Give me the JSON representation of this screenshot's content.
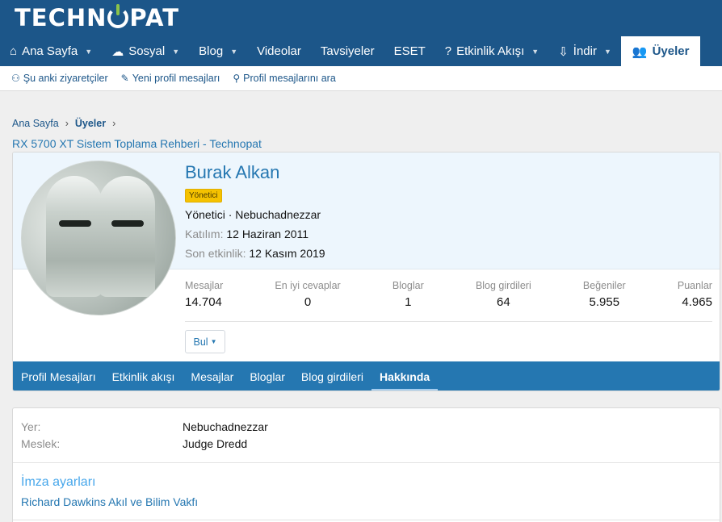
{
  "brand": {
    "logo_left": "TECHN",
    "logo_right": "PAT",
    "accent_color": "#1c5689",
    "power_color": "#8bc34a"
  },
  "nav": {
    "items": [
      {
        "label": "Ana Sayfa",
        "icon": "home-icon"
      },
      {
        "label": "Sosyal",
        "icon": "comments-icon"
      },
      {
        "label": "Blog"
      },
      {
        "label": "Videolar"
      },
      {
        "label": "Tavsiyeler"
      },
      {
        "label": "ESET"
      },
      {
        "label": "Etkinlik Akışı",
        "icon": "lightbulb-icon"
      },
      {
        "label": "İndir",
        "icon": "download-icon"
      },
      {
        "label": "Üyeler",
        "icon": "users-icon"
      }
    ]
  },
  "subnav": {
    "items": [
      {
        "label": "Şu anki ziyaretçiler",
        "icon": "user-plus-icon"
      },
      {
        "label": "Yeni profil mesajları",
        "icon": "pencil-icon"
      },
      {
        "label": "Profil mesajlarını ara",
        "icon": "search-user-icon"
      }
    ]
  },
  "breadcrumb": {
    "home": "Ana Sayfa",
    "members": "Üyeler"
  },
  "page_link": "RX 5700 XT Sistem Toplama Rehberi - Technopat",
  "profile": {
    "name": "Burak Alkan",
    "badge": "Yönetici",
    "title_line": "Yönetici · Nebuchadnezzar",
    "joined_label": "Katılım:",
    "joined_value": "12 Haziran 2011",
    "last_label": "Son etkinlik:",
    "last_value": "12 Kasım 2019",
    "stats": [
      {
        "label": "Mesajlar",
        "value": "14.704"
      },
      {
        "label": "En iyi cevaplar",
        "value": "0"
      },
      {
        "label": "Bloglar",
        "value": "1"
      },
      {
        "label": "Blog girdileri",
        "value": "64"
      },
      {
        "label": "Beğeniler",
        "value": "5.955"
      },
      {
        "label": "Puanlar",
        "value": "4.965"
      }
    ],
    "find_label": "Bul",
    "badge_color": "#f5c200"
  },
  "tabs": [
    {
      "label": "Profil Mesajları"
    },
    {
      "label": "Etkinlik akışı"
    },
    {
      "label": "Mesajlar"
    },
    {
      "label": "Bloglar"
    },
    {
      "label": "Blog girdileri"
    },
    {
      "label": "Hakkında"
    }
  ],
  "about": {
    "rows": [
      {
        "key": "Yer:",
        "value": "Nebuchadnezzar"
      },
      {
        "key": "Meslek:",
        "value": "Judge Dredd"
      }
    ],
    "signature_title": "İmza ayarları",
    "signature_text": "Richard Dawkins Akıl ve Bilim Vakfı"
  }
}
